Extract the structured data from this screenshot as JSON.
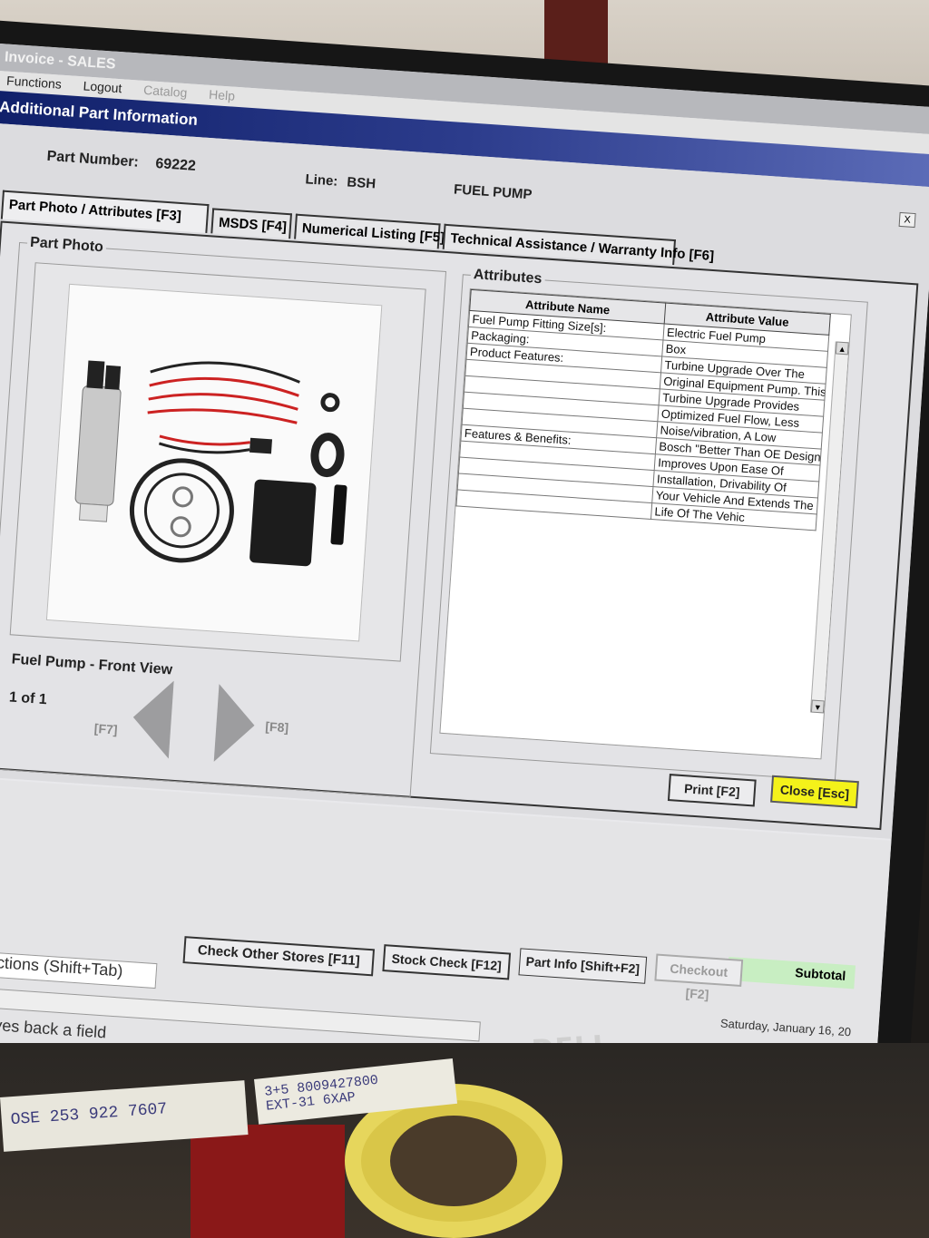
{
  "window": {
    "title": "Invoice - SALES"
  },
  "menu": [
    "Functions",
    "Logout",
    "Catalog",
    "Help"
  ],
  "dialog": {
    "title": "Additional Part Information",
    "close_x": "X",
    "part_number_label": "Part Number:",
    "part_number": "69222",
    "line_label": "Line:",
    "line": "BSH",
    "description": "FUEL PUMP"
  },
  "tabs": [
    {
      "label": "Part Photo / Attributes [F3]",
      "active": true
    },
    {
      "label": "MSDS [F4]"
    },
    {
      "label": "Numerical Listing [F5]"
    },
    {
      "label": "Technical Assistance / Warranty Info [F6]"
    }
  ],
  "photo": {
    "group_title": "Part Photo",
    "caption": "Fuel Pump - Front View",
    "counter": "1 of 1",
    "prev_key": "[F7]",
    "next_key": "[F8]"
  },
  "attributes": {
    "group_title": "Attributes",
    "headers": [
      "Attribute Name",
      "Attribute Value"
    ],
    "rows": [
      [
        "Fuel Pump Fitting Size[s]:",
        "Electric Fuel Pump"
      ],
      [
        "Packaging:",
        "Box"
      ],
      [
        "Product Features:",
        "Turbine Upgrade Over The"
      ],
      [
        "",
        "Original Equipment Pump. This"
      ],
      [
        "",
        "Turbine Upgrade Provides"
      ],
      [
        "",
        "Optimized Fuel Flow, Less"
      ],
      [
        "",
        "Noise/vibration, A Low"
      ],
      [
        "Features & Benefits:",
        "Bosch \"Better Than OE Design\","
      ],
      [
        "",
        "Improves Upon Ease Of"
      ],
      [
        "",
        "Installation, Drivability Of"
      ],
      [
        "",
        "Your Vehicle And Extends The"
      ],
      [
        "",
        "Life Of The Vehic"
      ]
    ]
  },
  "buttons": {
    "print": "Print [F2]",
    "close": "Close [Esc]"
  },
  "toolbar": {
    "subtotal": "Subtotal",
    "checkout": "Checkout [F2]",
    "part_info": "Part Info [Shift+F2]",
    "stock_check": "Stock Check [F12]",
    "check_other_stores": "Check Other Stores [F11]",
    "date": "Saturday, January 16, 20"
  },
  "status": {
    "special_functions": "cial Functions (Shift+Tab)",
    "hint": "-Tab moves back a field"
  },
  "environment": {
    "monitor_brand": "DELL",
    "note1": "OSE 253 922 7607",
    "note2_line1": "3+5 8009427800",
    "note2_line2": "EXT-31 6XAP"
  }
}
